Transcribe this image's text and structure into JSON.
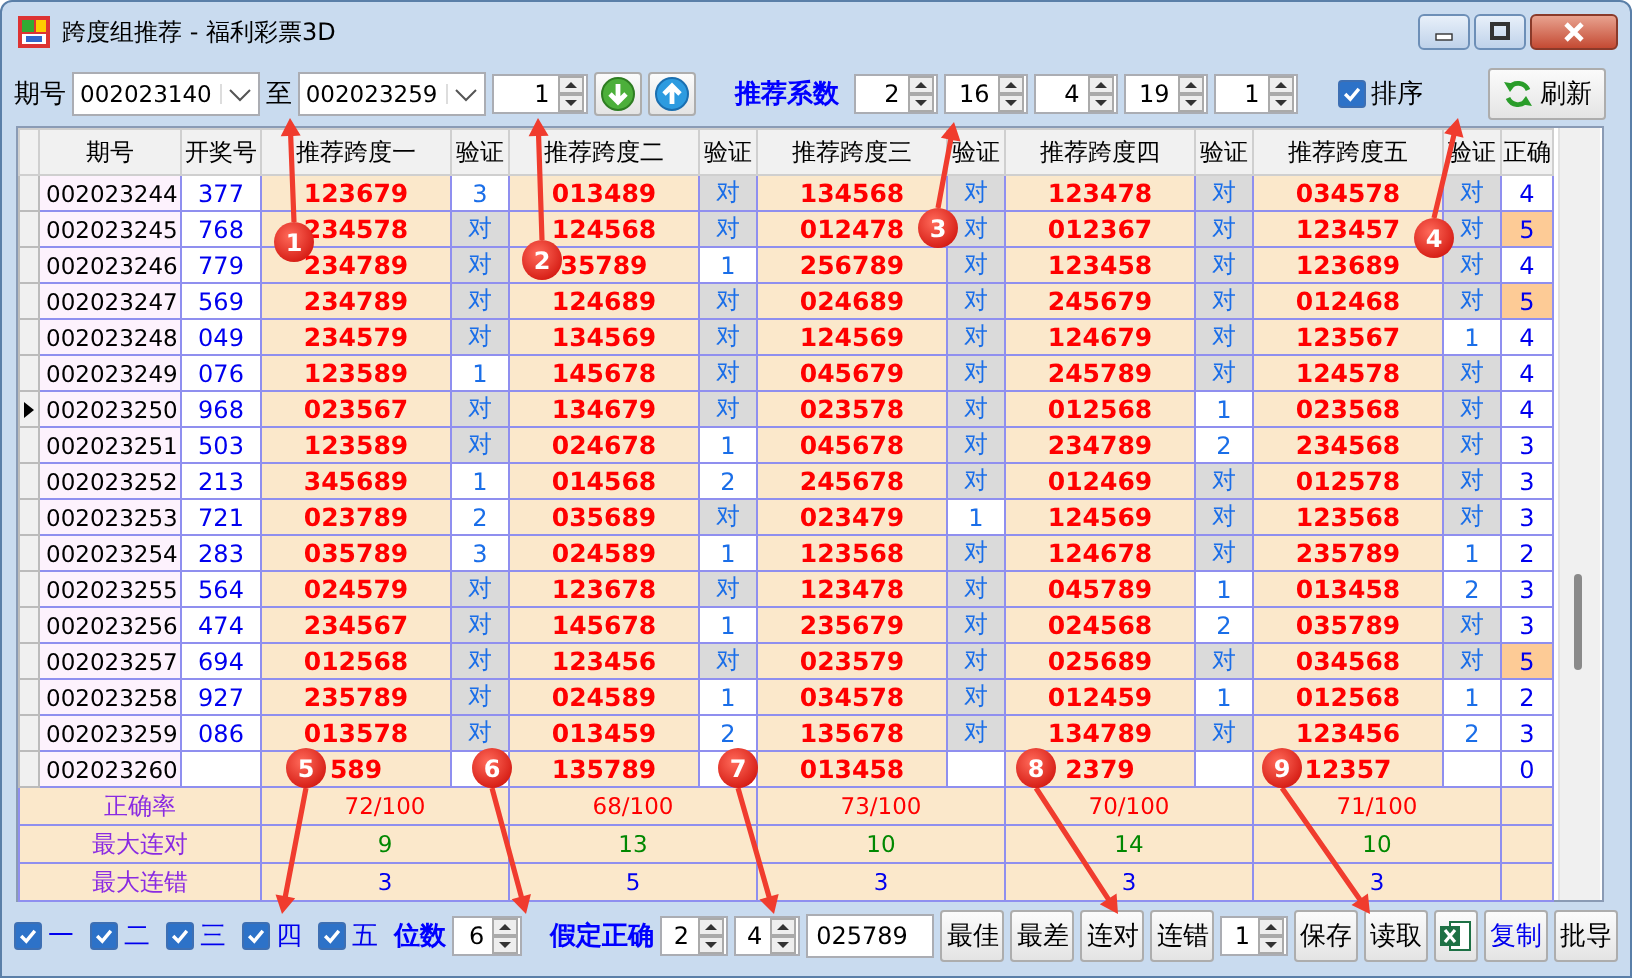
{
  "window": {
    "title": "跨度组推荐 - 福利彩票3D"
  },
  "toolbar": {
    "issue_label": "期号",
    "from_issue": "002023140",
    "to_label": "至",
    "to_issue": "002023259",
    "step": "1",
    "coef_label": "推荐系数",
    "coefficients": [
      "2",
      "16",
      "4",
      "19",
      "1"
    ],
    "sort": {
      "label": "排序",
      "checked": true
    },
    "refresh_label": "刷新"
  },
  "table": {
    "columns": [
      "期号",
      "开奖号",
      "推荐跨度一",
      "验证",
      "推荐跨度二",
      "验证",
      "推荐跨度三",
      "验证",
      "推荐跨度四",
      "验证",
      "推荐跨度五",
      "验证",
      "正确"
    ],
    "rows": [
      {
        "issue": "002023244",
        "draw": "377",
        "selected": false,
        "spans": [
          {
            "value": "123679",
            "check": "3",
            "hit": false
          },
          {
            "value": "013489",
            "check": "对",
            "hit": true
          },
          {
            "value": "134568",
            "check": "对",
            "hit": true
          },
          {
            "value": "123478",
            "check": "对",
            "hit": true
          },
          {
            "value": "034578",
            "check": "对",
            "hit": true
          }
        ],
        "correct": {
          "text": "4",
          "highlight": false
        }
      },
      {
        "issue": "002023245",
        "draw": "768",
        "selected": false,
        "spans": [
          {
            "value": "234578",
            "check": "对",
            "hit": true
          },
          {
            "value": "124568",
            "check": "对",
            "hit": true
          },
          {
            "value": "012478",
            "check": "对",
            "hit": true
          },
          {
            "value": "012367",
            "check": "对",
            "hit": true
          },
          {
            "value": "123457",
            "check": "对",
            "hit": true
          }
        ],
        "correct": {
          "text": "5",
          "highlight": true
        }
      },
      {
        "issue": "002023246",
        "draw": "779",
        "selected": false,
        "spans": [
          {
            "value": "234789",
            "check": "对",
            "hit": true
          },
          {
            "value": "35789",
            "check": "1",
            "hit": false
          },
          {
            "value": "256789",
            "check": "对",
            "hit": true
          },
          {
            "value": "123458",
            "check": "对",
            "hit": true
          },
          {
            "value": "123689",
            "check": "对",
            "hit": true
          }
        ],
        "correct": {
          "text": "4",
          "highlight": false
        }
      },
      {
        "issue": "002023247",
        "draw": "569",
        "selected": false,
        "spans": [
          {
            "value": "234789",
            "check": "对",
            "hit": true
          },
          {
            "value": "124689",
            "check": "对",
            "hit": true
          },
          {
            "value": "024689",
            "check": "对",
            "hit": true
          },
          {
            "value": "245679",
            "check": "对",
            "hit": true
          },
          {
            "value": "012468",
            "check": "对",
            "hit": true
          }
        ],
        "correct": {
          "text": "5",
          "highlight": true
        }
      },
      {
        "issue": "002023248",
        "draw": "049",
        "selected": false,
        "spans": [
          {
            "value": "234579",
            "check": "对",
            "hit": true
          },
          {
            "value": "134569",
            "check": "对",
            "hit": true
          },
          {
            "value": "124569",
            "check": "对",
            "hit": true
          },
          {
            "value": "124679",
            "check": "对",
            "hit": true
          },
          {
            "value": "123567",
            "check": "1",
            "hit": false
          }
        ],
        "correct": {
          "text": "4",
          "highlight": false
        }
      },
      {
        "issue": "002023249",
        "draw": "076",
        "selected": false,
        "spans": [
          {
            "value": "123589",
            "check": "1",
            "hit": false
          },
          {
            "value": "145678",
            "check": "对",
            "hit": true
          },
          {
            "value": "045679",
            "check": "对",
            "hit": true
          },
          {
            "value": "245789",
            "check": "对",
            "hit": true
          },
          {
            "value": "124578",
            "check": "对",
            "hit": true
          }
        ],
        "correct": {
          "text": "4",
          "highlight": false
        }
      },
      {
        "issue": "002023250",
        "draw": "968",
        "selected": true,
        "spans": [
          {
            "value": "023567",
            "check": "对",
            "hit": true
          },
          {
            "value": "134679",
            "check": "对",
            "hit": true
          },
          {
            "value": "023578",
            "check": "对",
            "hit": true
          },
          {
            "value": "012568",
            "check": "1",
            "hit": false
          },
          {
            "value": "023568",
            "check": "对",
            "hit": true
          }
        ],
        "correct": {
          "text": "4",
          "highlight": false
        }
      },
      {
        "issue": "002023251",
        "draw": "503",
        "selected": false,
        "spans": [
          {
            "value": "123589",
            "check": "对",
            "hit": true
          },
          {
            "value": "024678",
            "check": "1",
            "hit": false
          },
          {
            "value": "045678",
            "check": "对",
            "hit": true
          },
          {
            "value": "234789",
            "check": "2",
            "hit": false
          },
          {
            "value": "234568",
            "check": "对",
            "hit": true
          }
        ],
        "correct": {
          "text": "3",
          "highlight": false
        }
      },
      {
        "issue": "002023252",
        "draw": "213",
        "selected": false,
        "spans": [
          {
            "value": "345689",
            "check": "1",
            "hit": false
          },
          {
            "value": "014568",
            "check": "2",
            "hit": false
          },
          {
            "value": "245678",
            "check": "对",
            "hit": true
          },
          {
            "value": "012469",
            "check": "对",
            "hit": true
          },
          {
            "value": "012578",
            "check": "对",
            "hit": true
          }
        ],
        "correct": {
          "text": "3",
          "highlight": false
        }
      },
      {
        "issue": "002023253",
        "draw": "721",
        "selected": false,
        "spans": [
          {
            "value": "023789",
            "check": "2",
            "hit": false
          },
          {
            "value": "035689",
            "check": "对",
            "hit": true
          },
          {
            "value": "023479",
            "check": "1",
            "hit": false
          },
          {
            "value": "124569",
            "check": "对",
            "hit": true
          },
          {
            "value": "123568",
            "check": "对",
            "hit": true
          }
        ],
        "correct": {
          "text": "3",
          "highlight": false
        }
      },
      {
        "issue": "002023254",
        "draw": "283",
        "selected": false,
        "spans": [
          {
            "value": "035789",
            "check": "3",
            "hit": false
          },
          {
            "value": "024589",
            "check": "1",
            "hit": false
          },
          {
            "value": "123568",
            "check": "对",
            "hit": true
          },
          {
            "value": "124678",
            "check": "对",
            "hit": true
          },
          {
            "value": "235789",
            "check": "1",
            "hit": false
          }
        ],
        "correct": {
          "text": "2",
          "highlight": false
        }
      },
      {
        "issue": "002023255",
        "draw": "564",
        "selected": false,
        "spans": [
          {
            "value": "024579",
            "check": "对",
            "hit": true
          },
          {
            "value": "123678",
            "check": "对",
            "hit": true
          },
          {
            "value": "123478",
            "check": "对",
            "hit": true
          },
          {
            "value": "045789",
            "check": "1",
            "hit": false
          },
          {
            "value": "013458",
            "check": "2",
            "hit": false
          }
        ],
        "correct": {
          "text": "3",
          "highlight": false
        }
      },
      {
        "issue": "002023256",
        "draw": "474",
        "selected": false,
        "spans": [
          {
            "value": "234567",
            "check": "对",
            "hit": true
          },
          {
            "value": "145678",
            "check": "1",
            "hit": false
          },
          {
            "value": "235679",
            "check": "对",
            "hit": true
          },
          {
            "value": "024568",
            "check": "2",
            "hit": false
          },
          {
            "value": "035789",
            "check": "对",
            "hit": true
          }
        ],
        "correct": {
          "text": "3",
          "highlight": false
        }
      },
      {
        "issue": "002023257",
        "draw": "694",
        "selected": false,
        "spans": [
          {
            "value": "012568",
            "check": "对",
            "hit": true
          },
          {
            "value": "123456",
            "check": "对",
            "hit": true
          },
          {
            "value": "023579",
            "check": "对",
            "hit": true
          },
          {
            "value": "025689",
            "check": "对",
            "hit": true
          },
          {
            "value": "034568",
            "check": "对",
            "hit": true
          }
        ],
        "correct": {
          "text": "5",
          "highlight": true
        }
      },
      {
        "issue": "002023258",
        "draw": "927",
        "selected": false,
        "spans": [
          {
            "value": "235789",
            "check": "对",
            "hit": true
          },
          {
            "value": "024589",
            "check": "1",
            "hit": false
          },
          {
            "value": "034578",
            "check": "对",
            "hit": true
          },
          {
            "value": "012459",
            "check": "1",
            "hit": false
          },
          {
            "value": "012568",
            "check": "1",
            "hit": false
          }
        ],
        "correct": {
          "text": "2",
          "highlight": false
        }
      },
      {
        "issue": "002023259",
        "draw": "086",
        "selected": false,
        "spans": [
          {
            "value": "013578",
            "check": "对",
            "hit": true
          },
          {
            "value": "013459",
            "check": "2",
            "hit": false
          },
          {
            "value": "135678",
            "check": "对",
            "hit": true
          },
          {
            "value": "134789",
            "check": "对",
            "hit": true
          },
          {
            "value": "123456",
            "check": "2",
            "hit": false
          }
        ],
        "correct": {
          "text": "3",
          "highlight": false
        }
      },
      {
        "issue": "002023260",
        "selected": false,
        "spans": [
          {
            "value": "589",
            "hit": false
          },
          {
            "value": "135789",
            "hit": false
          },
          {
            "value": "013458",
            "hit": false
          },
          {
            "value": "2379",
            "hit": false
          },
          {
            "value": "12357",
            "hit": false
          }
        ],
        "correct": {
          "text": "0",
          "highlight": false
        }
      }
    ],
    "stats": [
      {
        "label": "正确率",
        "kind": "rate",
        "values": [
          "72/100",
          "68/100",
          "73/100",
          "70/100",
          "71/100"
        ]
      },
      {
        "label": "最大连对",
        "kind": "max_hit",
        "values": [
          "9",
          "13",
          "10",
          "14",
          "10"
        ]
      },
      {
        "label": "最大连错",
        "kind": "max_miss",
        "values": [
          "3",
          "5",
          "3",
          "3",
          "3"
        ]
      }
    ]
  },
  "bottom_bar": {
    "positions": [
      {
        "label": "一",
        "checked": true
      },
      {
        "label": "二",
        "checked": true
      },
      {
        "label": "三",
        "checked": true
      },
      {
        "label": "四",
        "checked": true
      },
      {
        "label": "五",
        "checked": true
      }
    ],
    "digits_label": "位数",
    "digits": "6",
    "assume_label": "假定正确",
    "assume_from": "2",
    "assume_to": "4",
    "combo": "025789",
    "buttons_a": [
      "最佳",
      "最差",
      "连对",
      "连错"
    ],
    "count": "1",
    "buttons_b": [
      "保存",
      "读取"
    ],
    "copy_label": "复制",
    "batch_label": "批导"
  },
  "annotations": [
    {
      "label": "1"
    },
    {
      "label": "2"
    },
    {
      "label": "3"
    },
    {
      "label": "4"
    },
    {
      "label": "5"
    },
    {
      "label": "6"
    },
    {
      "label": "7"
    },
    {
      "label": "8"
    },
    {
      "label": "9"
    }
  ]
}
